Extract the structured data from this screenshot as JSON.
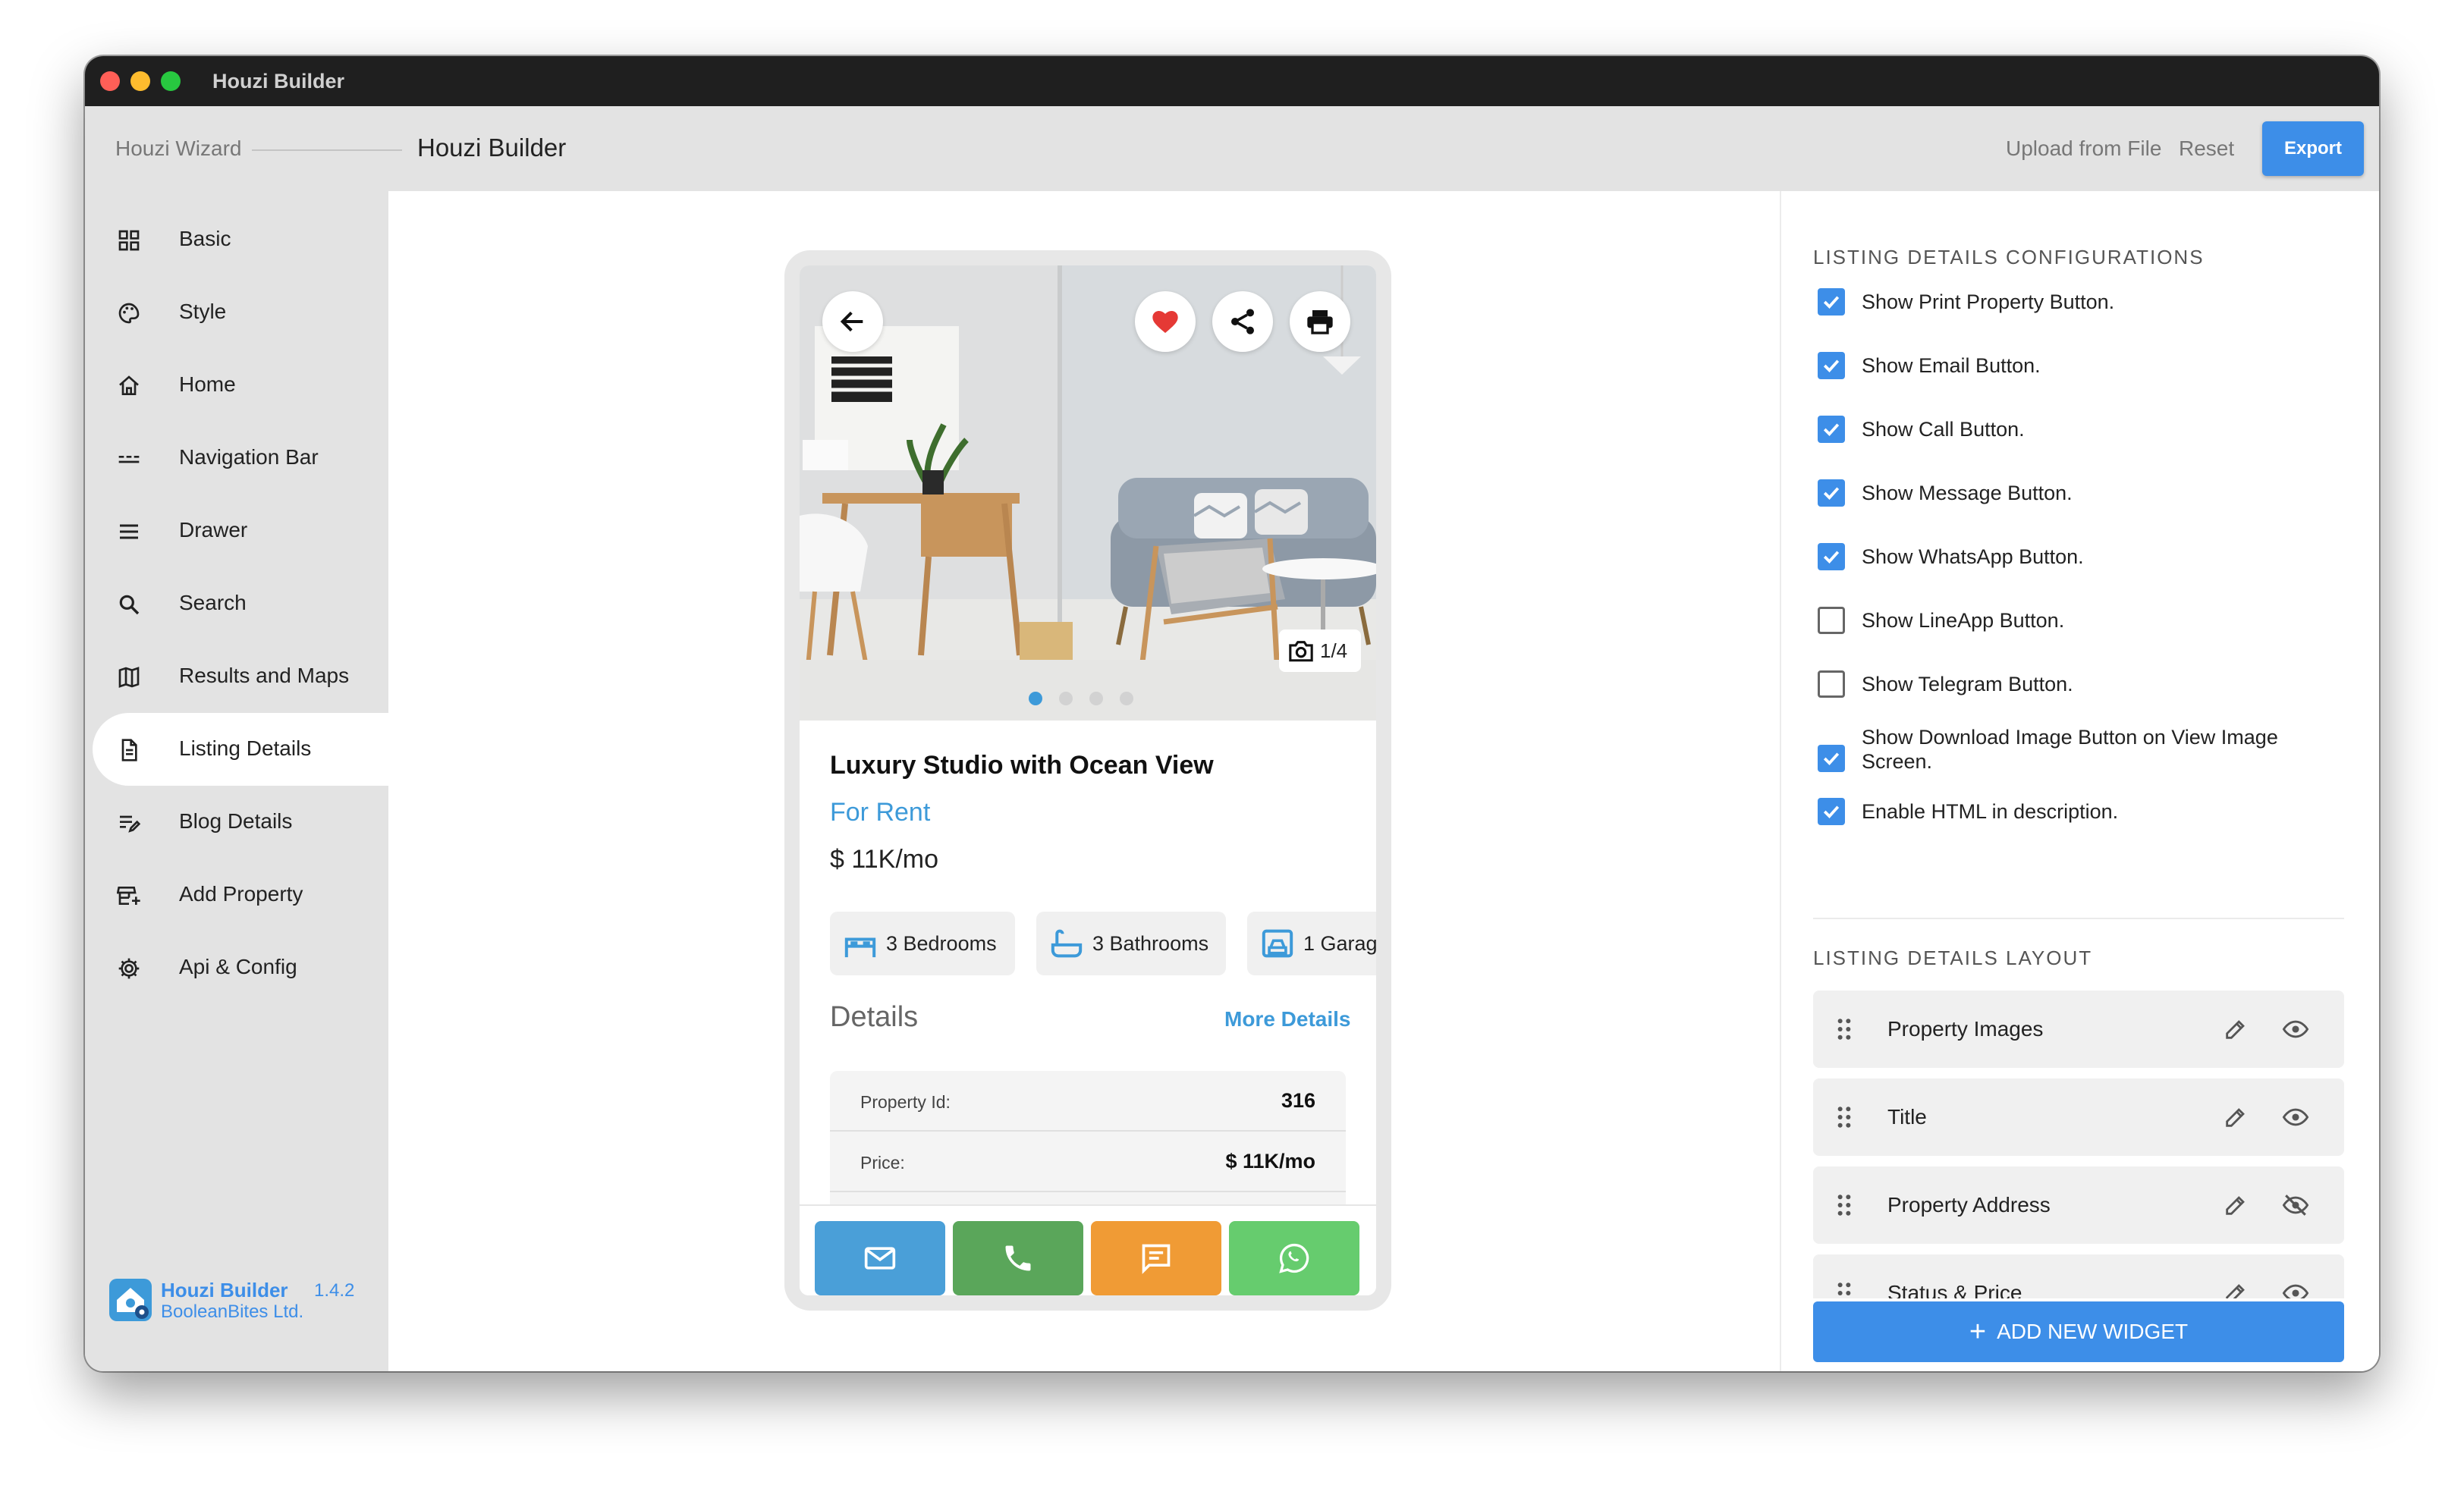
{
  "window": {
    "title": "Houzi Builder"
  },
  "header": {
    "breadcrumb_root": "Houzi Wizard",
    "breadcrumb_current": "Houzi Builder",
    "upload_label": "Upload from File",
    "reset_label": "Reset",
    "export_label": "Export"
  },
  "sidebar": {
    "items": [
      {
        "label": "Basic",
        "icon": "grid-icon"
      },
      {
        "label": "Style",
        "icon": "palette-icon"
      },
      {
        "label": "Home",
        "icon": "home-icon"
      },
      {
        "label": "Navigation Bar",
        "icon": "navigation-bar-icon"
      },
      {
        "label": "Drawer",
        "icon": "menu-icon"
      },
      {
        "label": "Search",
        "icon": "search-icon"
      },
      {
        "label": "Results and Maps",
        "icon": "map-icon"
      },
      {
        "label": "Listing Details",
        "icon": "document-icon",
        "active": true
      },
      {
        "label": "Blog Details",
        "icon": "edit-note-icon"
      },
      {
        "label": "Add Property",
        "icon": "add-business-icon"
      },
      {
        "label": "Api & Config",
        "icon": "gear-icon"
      }
    ],
    "brand": {
      "name": "Houzi Builder",
      "version": "1.4.2",
      "company": "BooleanBites Ltd."
    }
  },
  "preview": {
    "image_counter": "1/4",
    "title": "Luxury Studio with Ocean View",
    "status": "For Rent",
    "price": "$ 11K/mo",
    "features": [
      "3 Bedrooms",
      "3 Bathrooms",
      "1 Garag"
    ],
    "details_heading": "Details",
    "more_details_label": "More Details",
    "details": [
      {
        "key": "Property Id:",
        "value": "316"
      },
      {
        "key": "Price:",
        "value": "$ 11K/mo"
      }
    ],
    "actions": [
      {
        "icon": "email-icon",
        "color": "#4a9fd8"
      },
      {
        "icon": "phone-icon",
        "color": "#5aa65a"
      },
      {
        "icon": "message-icon",
        "color": "#f09b35"
      },
      {
        "icon": "whatsapp-icon",
        "color": "#66cc6e"
      }
    ]
  },
  "config": {
    "section_title": "LISTING DETAILS CONFIGURATIONS",
    "options": [
      {
        "label": "Show Print Property Button.",
        "checked": true
      },
      {
        "label": "Show Email Button.",
        "checked": true
      },
      {
        "label": "Show Call Button.",
        "checked": true
      },
      {
        "label": "Show Message Button.",
        "checked": true
      },
      {
        "label": "Show WhatsApp Button.",
        "checked": true
      },
      {
        "label": "Show LineApp Button.",
        "checked": false
      },
      {
        "label": "Show Telegram Button.",
        "checked": false
      },
      {
        "label": "Show Download Image Button on View Image Screen.",
        "checked": true
      },
      {
        "label": "Enable HTML in description.",
        "checked": true
      }
    ],
    "layout_title": "LISTING DETAILS LAYOUT",
    "layout_items": [
      {
        "label": "Property Images",
        "visible": true
      },
      {
        "label": "Title",
        "visible": true
      },
      {
        "label": "Property Address",
        "visible": false
      },
      {
        "label": "Status & Price",
        "visible": true
      }
    ],
    "add_widget_label": "ADD NEW WIDGET"
  },
  "colors": {
    "accent": "#3d8ee8",
    "status": "#3d9ad9",
    "favorite": "#e53935"
  }
}
